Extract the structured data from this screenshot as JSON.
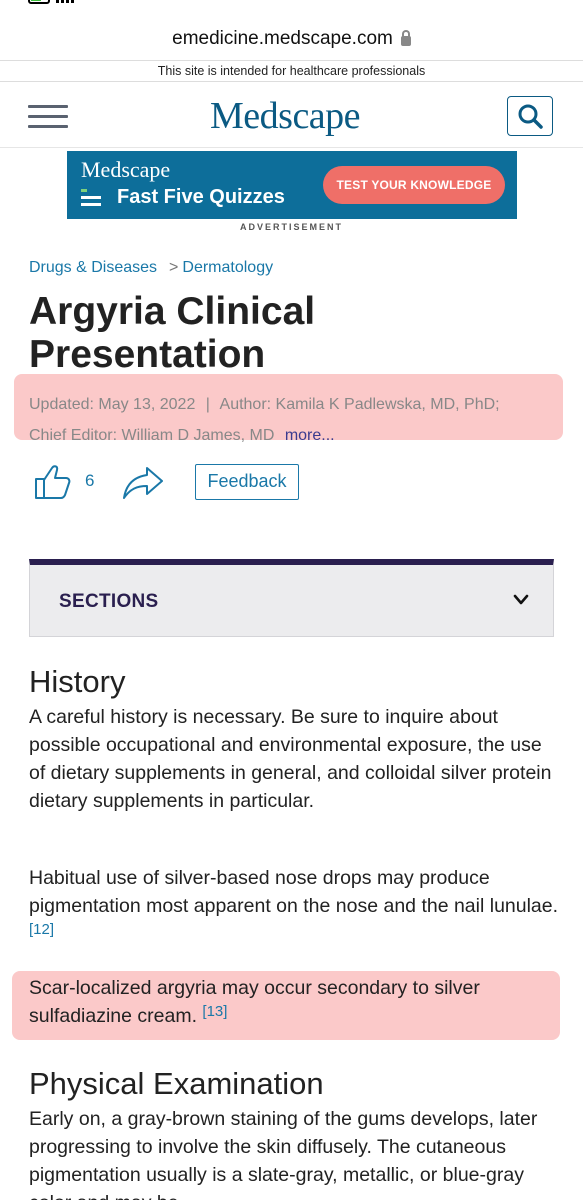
{
  "url_bar": {
    "domain": "emedicine.medscape.com"
  },
  "hcp_banner": "This site is intended for healthcare professionals",
  "header": {
    "logo": "Medscape"
  },
  "ad": {
    "brand": "Medscape",
    "title": "Fast Five Quizzes",
    "cta": "TEST YOUR KNOWLEDGE",
    "label": "ADVERTISEMENT",
    "background_color": "#0d6e9a",
    "cta_color": "#ef6f68"
  },
  "breadcrumb": {
    "item1": "Drugs & Diseases",
    "separator": ">",
    "item2": "Dermatology"
  },
  "article": {
    "title": "Argyria Clinical Presentation",
    "updated": "Updated: May 13, 2022",
    "divider": "|",
    "author": "Author: Kamila K Padlewska, MD, PhD;",
    "chief_editor": "Chief Editor: William D James, MD",
    "more": "more..."
  },
  "actions": {
    "like_count": "6",
    "feedback": "Feedback"
  },
  "sections_toggle": {
    "label": "SECTIONS"
  },
  "content": {
    "history_heading": "History",
    "history_p1": "A careful history is necessary. Be sure to inquire about possible occupational and environmental exposure, the use of dietary supplements in general, and colloidal silver protein dietary supplements in particular.",
    "history_p2": "Habitual use of silver-based nose drops may produce pigmentation most apparent on the nose and the nail lunulae.",
    "history_p2_ref": "[12]",
    "history_p3": "Scar-localized argyria may occur secondary to silver sulfadiazine cream.",
    "history_p3_ref": "[13]",
    "exam_heading": "Physical Examination",
    "exam_p1": "Early on, a gray-brown staining of the gums develops, later progressing to involve the skin diffusely. The cutaneous pigmentation usually is a slate-gray, metallic, or blue-gray color and may be"
  },
  "colors": {
    "link": "#1a78a8",
    "brand": "#0b5a83",
    "highlight": "#fbc9c9",
    "sections_accent": "#2a1f4f"
  }
}
